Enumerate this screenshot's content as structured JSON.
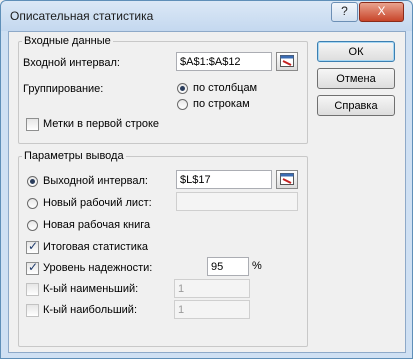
{
  "window": {
    "title": "Описательная статистика",
    "help_symbol": "?",
    "close_symbol": "X"
  },
  "input_group": {
    "title": "Входные данные",
    "range_label": "Входной интервал:",
    "range_value": "$A$1:$A$12",
    "grouping_label": "Группирование:",
    "by_columns": "по столбцам",
    "by_rows": "по строкам",
    "labels_first_row": "Метки в первой строке"
  },
  "output_group": {
    "title": "Параметры вывода",
    "output_range_label": "Выходной интервал:",
    "output_range_value": "$L$17",
    "new_sheet_label": "Новый рабочий лист:",
    "new_sheet_value": "",
    "new_book_label": "Новая рабочая книга",
    "summary_stats": "Итоговая статистика",
    "confidence_label": "Уровень надежности:",
    "confidence_value": "95",
    "percent": "%",
    "kth_smallest_label": "К-ый наименьший:",
    "kth_smallest_value": "1",
    "kth_largest_label": "К-ый наибольший:",
    "kth_largest_value": "1"
  },
  "buttons": {
    "ok": "ОК",
    "cancel": "Отмена",
    "help": "Справка"
  }
}
